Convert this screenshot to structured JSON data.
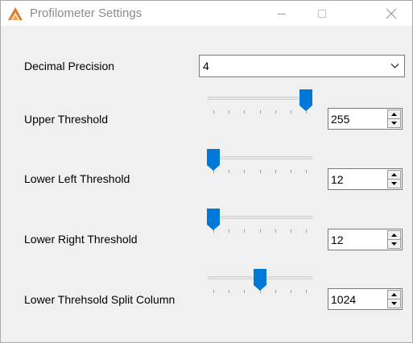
{
  "window": {
    "title": "Profilometer Settings"
  },
  "colors": {
    "accent": "#0078d7",
    "app_icon": "#e07b2a"
  },
  "decimal_precision": {
    "label": "Decimal Precision",
    "value": "4"
  },
  "upper_threshold": {
    "label": "Upper Threshold",
    "value": "255",
    "slider_fraction": 1.0
  },
  "lower_left_threshold": {
    "label": "Lower Left Threshold",
    "value": "12",
    "slider_fraction": 0.0
  },
  "lower_right_threshold": {
    "label": "Lower Right Threshold",
    "value": "12",
    "slider_fraction": 0.0
  },
  "lower_threshold_split_column": {
    "label": "Lower Threhsold Split Column",
    "value": "1024",
    "slider_fraction": 0.5
  },
  "icons": [
    "app-icon",
    "minimize-icon",
    "maximize-icon",
    "close-icon",
    "chevron-down-icon",
    "spin-up-icon",
    "spin-down-icon"
  ]
}
